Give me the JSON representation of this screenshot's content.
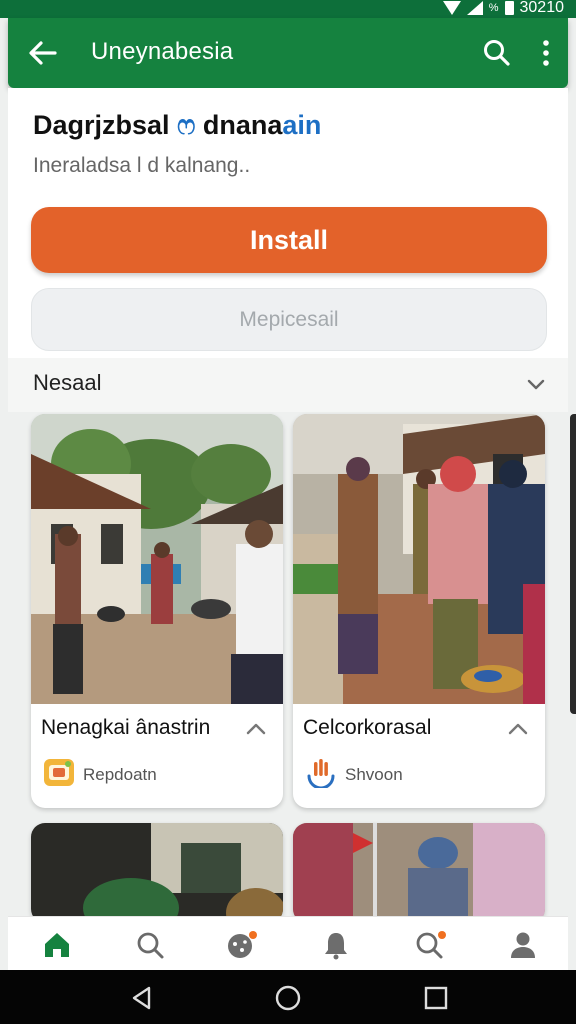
{
  "status_bar": {
    "time": "30210",
    "battery_label": "%"
  },
  "app_bar": {
    "title": "Uneynabesia"
  },
  "app": {
    "name_primary": "Dagrjzbsal",
    "name_symbol": "ෆ",
    "name_secondary_dark": "dnana",
    "name_secondary_blue": "ain",
    "subtitle": "Ineraladsa l d kalnang.."
  },
  "buttons": {
    "install_label": "Install",
    "secondary_label": "Mepicesail"
  },
  "section": {
    "label": "Nesaal"
  },
  "cards": [
    {
      "title": "Nenagkai ânastrin",
      "subtitle": "Repdoatn",
      "icon": "folder-app-icon"
    },
    {
      "title": "Celcorkorasal",
      "subtitle": "Shvoon",
      "icon": "hand-app-icon"
    }
  ],
  "bottom_nav": {
    "items": [
      {
        "name": "home",
        "icon": "home-icon",
        "active": true
      },
      {
        "name": "search",
        "icon": "search-icon"
      },
      {
        "name": "games",
        "icon": "games-icon",
        "badge": true
      },
      {
        "name": "notifications",
        "icon": "bell-icon"
      },
      {
        "name": "discover",
        "icon": "discover-icon",
        "badge": true
      },
      {
        "name": "profile",
        "icon": "person-icon"
      }
    ]
  },
  "colors": {
    "app_bar": "#15823f",
    "status_bar": "#0d6f3a",
    "install_button": "#e3622a",
    "accent_blue": "#1d6fc4",
    "nav_active": "#15823f"
  }
}
